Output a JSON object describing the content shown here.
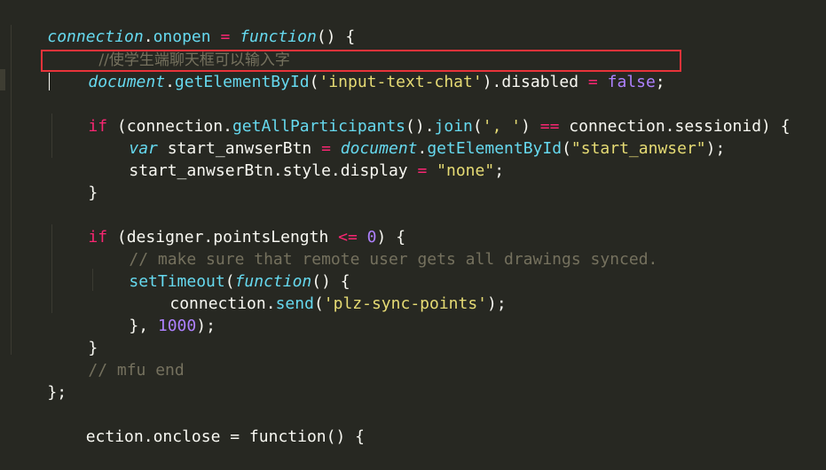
{
  "code": {
    "l0_obj": "connection",
    "l0_dot": ".",
    "l0_prop": "onopen",
    "l0_eq": " = ",
    "l0_kw": "function",
    "l0_rest": "() {",
    "l1_comment": "//使学生端聊天框可以输入字",
    "l2_obj": "document",
    "l2_dot": ".",
    "l2_fn": "getElementById",
    "l2_p1": "(",
    "l2_str": "'input-text-chat'",
    "l2_p2": ").disabled ",
    "l2_eq": "=",
    "l2_sp": " ",
    "l2_bool": "false",
    "l2_end": ";",
    "l4_kw": "if",
    "l4_a": " (connection.",
    "l4_fn1": "getAllParticipants",
    "l4_b": "().",
    "l4_fn2": "join",
    "l4_c": "(",
    "l4_str": "', '",
    "l4_d": ") ",
    "l4_op": "==",
    "l4_e": " connection.sessionid) {",
    "l5_kw": "var",
    "l5_a": " start_anwserBtn ",
    "l5_eq": "=",
    "l5_sp": " ",
    "l5_obj": "document",
    "l5_dot": ".",
    "l5_fn": "getElementById",
    "l5_p1": "(",
    "l5_str": "\"start_anwser\"",
    "l5_end": ");",
    "l6_a": "start_anwserBtn.style.display ",
    "l6_eq": "=",
    "l6_sp": " ",
    "l6_str": "\"none\"",
    "l6_end": ";",
    "l7": "}",
    "l9_kw": "if",
    "l9_a": " (designer.pointsLength ",
    "l9_op": "<=",
    "l9_sp": " ",
    "l9_num": "0",
    "l9_end": ") {",
    "l10_comment": "// make sure that remote user gets all drawings synced.",
    "l11_fn": "setTimeout",
    "l11_p": "(",
    "l11_kw": "function",
    "l11_end": "() {",
    "l12_a": "connection.",
    "l12_fn": "send",
    "l12_p1": "(",
    "l12_str": "'plz-sync-points'",
    "l12_end": ");",
    "l13_a": "}, ",
    "l13_num": "1000",
    "l13_end": ");",
    "l14": "}",
    "l15_comment": "// mfu end",
    "l16": "};",
    "bottom_partial": "    ection.onclose = function() {"
  },
  "colors": {
    "background": "#272822",
    "keyword": "#66d9ef",
    "operator": "#f92672",
    "string": "#e6db74",
    "number": "#ae81ff",
    "comment": "#75715e",
    "highlight_box": "#e8333a"
  }
}
